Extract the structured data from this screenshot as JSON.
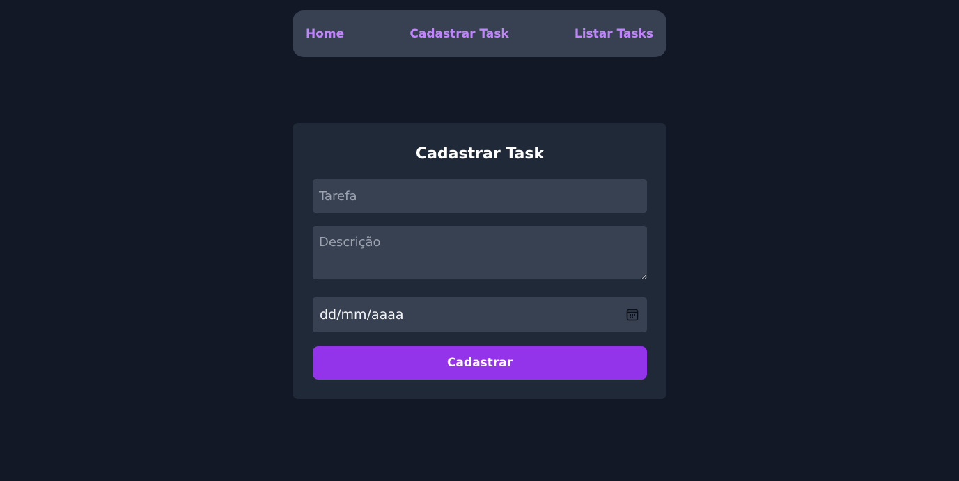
{
  "nav": {
    "home": "Home",
    "cadastrar": "Cadastrar Task",
    "listar": "Listar Tasks"
  },
  "form": {
    "title": "Cadastrar Task",
    "task_placeholder": "Tarefa",
    "task_value": "",
    "description_placeholder": "Descrição",
    "description_value": "",
    "date_placeholder": "dd/mm/aaaa",
    "date_icon": "calendar-icon",
    "submit_label": "Cadastrar"
  },
  "colors": {
    "background": "#131827",
    "nav_background": "#374151",
    "card_background": "#1f2937",
    "link": "#c084fc",
    "accent": "#9333ea"
  }
}
